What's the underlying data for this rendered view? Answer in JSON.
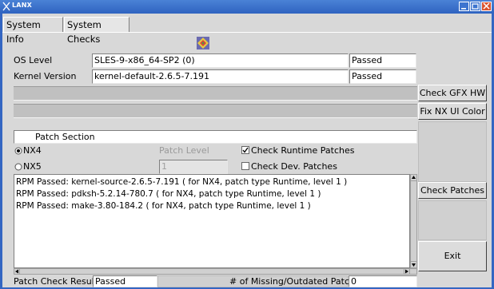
{
  "window": {
    "title": "LANX"
  },
  "tabs": [
    {
      "label": "System Info"
    },
    {
      "label": "System Checks"
    }
  ],
  "checks": {
    "os_level": {
      "label": "OS Level",
      "value": "SLES-9-x86_64-SP2 (0)",
      "status": "Passed"
    },
    "kernel": {
      "label": "Kernel Version",
      "value": "kernel-default-2.6.5-7.191",
      "status": "Passed"
    }
  },
  "buttons": {
    "check_gfx": "Check GFX HW",
    "fix_nx": "Fix NX UI Color",
    "check_patches": "Check Patches",
    "exit": "Exit"
  },
  "patch": {
    "section_label": "Patch Section",
    "nx4": "NX4",
    "nx5": "NX5",
    "patch_level_label": "Patch Level",
    "patch_level_value": "1",
    "check_runtime": "Check Runtime Patches",
    "check_dev": "Check Dev. Patches",
    "nx4_selected": true,
    "runtime_checked": true,
    "dev_checked": false
  },
  "log": [
    "RPM Passed: kernel-source-2.6.5-7.191   ( for NX4, patch type Runtime, level 1 )",
    "RPM Passed: pdksh-5.2.14-780.7  ( for NX4, patch type Runtime, level 1 )",
    "RPM Passed: make-3.80-184.2   ( for NX4, patch type Runtime, level 1 )"
  ],
  "footer": {
    "results_label": "Patch Check Results",
    "results_value": "Passed",
    "missing_label": "# of Missing/Outdated Patches",
    "missing_value": "0"
  },
  "icons": {
    "window_logo": "lanx-logo-icon",
    "status_image": "checker-icon"
  }
}
